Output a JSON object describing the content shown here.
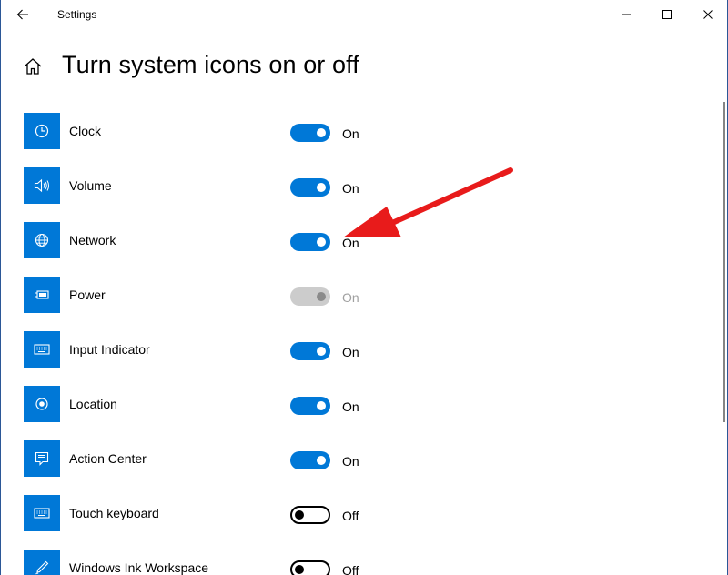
{
  "window": {
    "title": "Settings",
    "back_icon": "back-arrow-icon",
    "controls": [
      "minimize-icon",
      "maximize-icon",
      "close-icon"
    ]
  },
  "header": {
    "home_icon": "home-icon",
    "title": "Turn system icons on or off"
  },
  "items": [
    {
      "label": "Clock",
      "icon": "clock-icon",
      "state": "On",
      "enabled": true
    },
    {
      "label": "Volume",
      "icon": "volume-icon",
      "state": "On",
      "enabled": true
    },
    {
      "label": "Network",
      "icon": "network-globe-icon",
      "state": "On",
      "enabled": true
    },
    {
      "label": "Power",
      "icon": "battery-power-icon",
      "state": "On",
      "enabled": false
    },
    {
      "label": "Input Indicator",
      "icon": "keyboard-icon",
      "state": "On",
      "enabled": true
    },
    {
      "label": "Location",
      "icon": "location-icon",
      "state": "On",
      "enabled": true
    },
    {
      "label": "Action Center",
      "icon": "action-center-icon",
      "state": "On",
      "enabled": true
    },
    {
      "label": "Touch keyboard",
      "icon": "keyboard-icon",
      "state": "Off",
      "enabled": true
    },
    {
      "label": "Windows Ink Workspace",
      "icon": "pen-icon",
      "state": "Off",
      "enabled": true
    }
  ],
  "colors": {
    "accent": "#0078d7",
    "annotation_arrow": "#e81b1b",
    "disabled_toggle": "#cccccc"
  },
  "annotation": {
    "type": "red-arrow",
    "points_to": "Network toggle state"
  }
}
